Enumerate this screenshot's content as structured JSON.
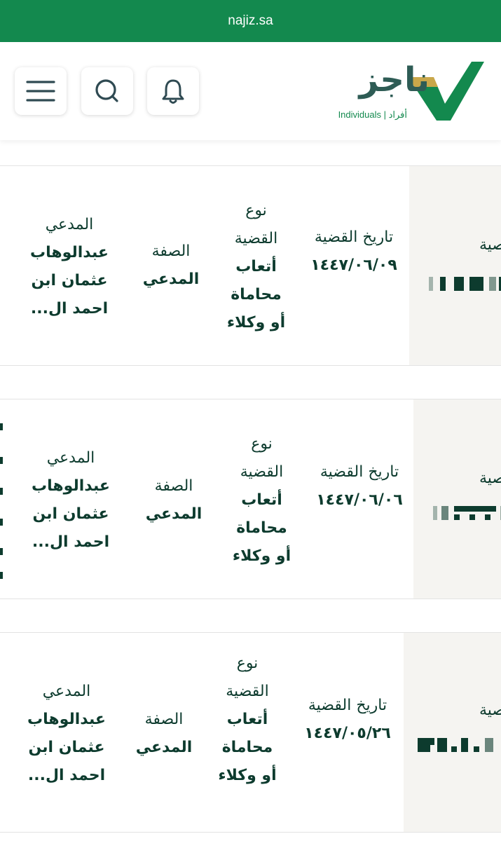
{
  "browser": {
    "url": "najiz.sa"
  },
  "header": {
    "logo_text": "ناجز",
    "logo_subtitle": "Individuals | أفراد",
    "menu_icon": "hamburger-menu-icon",
    "search_icon": "search-icon",
    "bell_icon": "bell-icon",
    "brand_color": "#13894e",
    "accent_color": "#c9a74a"
  },
  "labels": {
    "case_type": "نوع القضية",
    "case_date": "تاريخ القضية",
    "capacity": "الصفة",
    "plaintiff": "المدعي",
    "case_number_partial": "صية"
  },
  "cases": [
    {
      "case_date": "١٤٤٧/٠٦/٠٩",
      "case_type": "أتعاب محاماة أو وكلاء",
      "capacity": "المدعي",
      "plaintiff": "عبدالوهاب عثمان ابن احمد ال..."
    },
    {
      "case_date": "١٤٤٧/٠٦/٠٦",
      "case_type": "أتعاب محاماة أو وكلاء",
      "capacity": "المدعي",
      "plaintiff": "عبدالوهاب عثمان ابن احمد ال..."
    },
    {
      "case_date": "١٤٤٧/٠٥/٢٦",
      "case_type": "أتعاب محاماة أو وكلاء",
      "capacity": "المدعي",
      "plaintiff": "عبدالوهاب عثمان ابن احمد ال..."
    }
  ]
}
